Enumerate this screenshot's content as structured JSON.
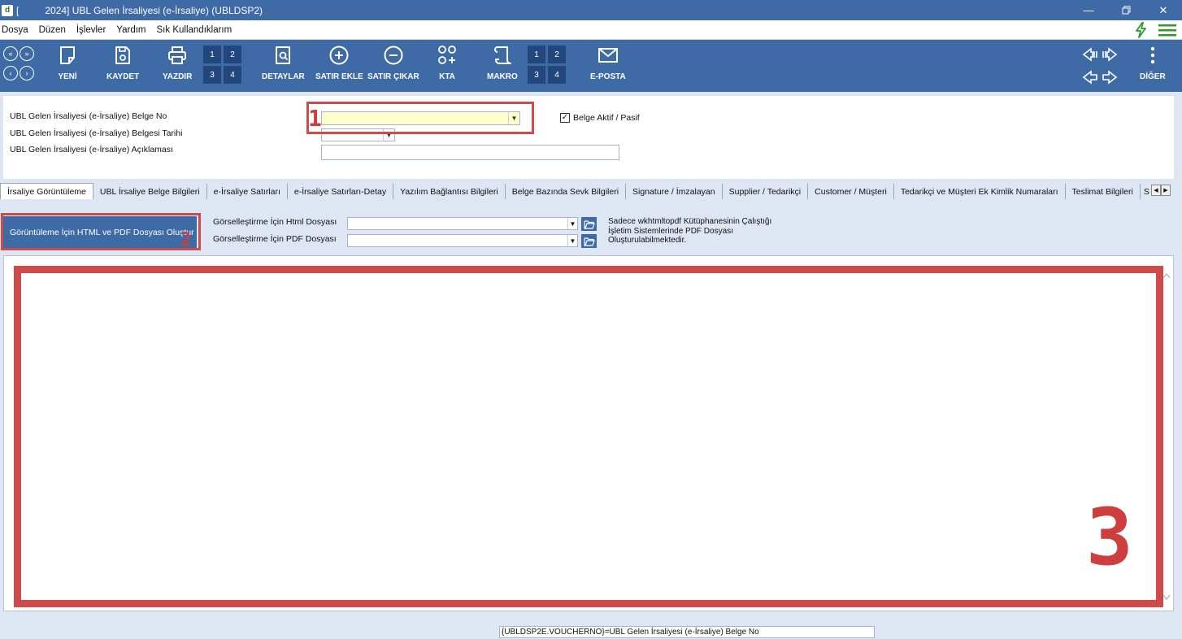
{
  "window": {
    "logo": "d",
    "title_prefix": "[",
    "title": "2024] UBL Gelen İrsaliyesi (e-İrsaliye) (UBLDSP2)",
    "controls": [
      "minimize-icon",
      "restore-icon",
      "close-icon"
    ]
  },
  "menu": {
    "items": [
      "Dosya",
      "Düzen",
      "İşlevler",
      "Yardım",
      "Sık Kullandıklarım"
    ]
  },
  "toolbar": {
    "new_label": "YENİ",
    "save_label": "KAYDET",
    "print_label": "YAZDIR",
    "print_grid": [
      "1",
      "2",
      "3",
      "4"
    ],
    "details_label": "DETAYLAR",
    "add_row_label": "SATIR EKLE",
    "remove_row_label": "SATIR ÇIKAR",
    "kta_label": "KTA",
    "macro_label": "MAKRO",
    "macro_grid": [
      "1",
      "2",
      "3",
      "4"
    ],
    "email_label": "E-POSTA",
    "more_label": "DİĞER"
  },
  "form": {
    "doc_no_label": "UBL Gelen İrsaliyesi (e-İrsaliye) Belge No",
    "doc_date_label": "UBL Gelen İrsaliyesi (e-İrsaliye) Belgesi Tarihi",
    "doc_desc_label": "UBL Gelen İrsaliyesi (e-İrsaliye) Açıklaması",
    "doc_no_value": "",
    "doc_date_value": "",
    "doc_desc_value": "",
    "active_label": "Belge Aktif / Pasif",
    "active_checked": true
  },
  "callouts": [
    "1",
    "2",
    "3"
  ],
  "tabs": [
    "İrsaliye Görüntüleme",
    "UBL İrsaliye Belge Bilgileri",
    "e-İrsaliye Satırları",
    "e-İrsaliye Satırları-Detay",
    "Yazılım Bağlantısı Bilgileri",
    "Belge Bazında Sevk Bilgileri",
    "Signature / İmzalayan",
    "Supplier / Tedarikçi",
    "Customer / Müşteri",
    "Tedarikçi ve Müşteri Ek Kimlik Numaraları",
    "Teslimat Bilgileri",
    "S"
  ],
  "viewer_tab": {
    "generate_button": "Görüntüleme İçin HTML ve PDF Dosyası Oluştur",
    "html_label": "Görselleştirme İçin Html Dosyası",
    "pdf_label": "Görselleştirme İçin PDF Dosyası",
    "html_value": "",
    "pdf_value": "",
    "note_line1": "Sadece wkhtmltopdf Kütüphanesinin Çalıştığı",
    "note_line2": "İşletim Sistemlerinde PDF Dosyası",
    "note_line3": "Oluşturulabilmektedir."
  },
  "status": {
    "field_text": "{UBLDSP2E.VOUCHERNO}=UBL Gelen İrsaliyesi (e-İrsaliye) Belge No"
  },
  "colors": {
    "primary": "#3e6aa6",
    "callout_red": "#cf4b4b",
    "highlight_yellow": "#ffffcc",
    "background": "#dde6f2"
  }
}
